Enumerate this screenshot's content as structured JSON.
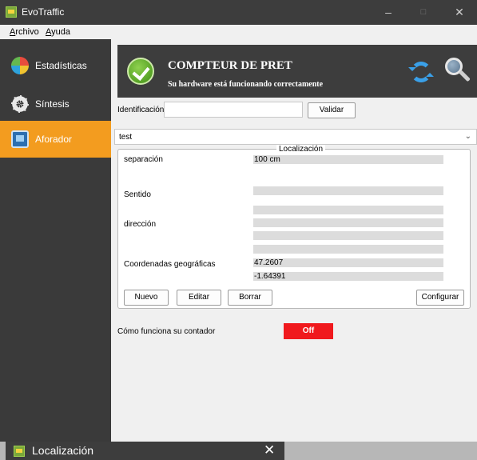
{
  "window": {
    "title": "EvoTraffic",
    "minimize": "–",
    "maximize": "□",
    "close": "✕"
  },
  "menu": {
    "archivo_accel": "A",
    "archivo_rest": "rchivo",
    "ayuda_accel": "A",
    "ayuda_rest": "yuda"
  },
  "sidebar": {
    "items": [
      {
        "label": "Estadísticas",
        "icon": "pie-chart-icon",
        "active": false
      },
      {
        "label": "Síntesis",
        "icon": "gear-icon",
        "active": false
      },
      {
        "label": "Aforador",
        "icon": "counter-icon",
        "active": true
      }
    ],
    "active_color": "#f39c1f",
    "background": "#3a3a3a"
  },
  "header": {
    "title": "COMPTEUR DE PRET",
    "subtitle": "Su hardware está funcionando correctamente",
    "status_icon": "check-circle-icon",
    "actions": [
      "refresh-icon",
      "search-icon"
    ]
  },
  "identification": {
    "label": "Identificación",
    "value": "",
    "validate_label": "Validar"
  },
  "counter_select": {
    "selected": "test"
  },
  "location": {
    "group_title": "Localización",
    "separation_label": "separación",
    "separation_value": "100 cm",
    "direction_label": "Sentido",
    "address_label": "dirección",
    "coords_label": "Coordenadas geográficas",
    "latitude": "47.2607",
    "longitude": "-1.64391",
    "buttons": {
      "new": "Nuevo",
      "edit": "Editar",
      "delete": "Borrar",
      "configure": "Configurar"
    }
  },
  "operation": {
    "label": "Cómo funciona su contador",
    "toggle": "Off",
    "toggle_color": "#f0191d"
  },
  "popup": {
    "title": "Localización",
    "close": "✕"
  }
}
